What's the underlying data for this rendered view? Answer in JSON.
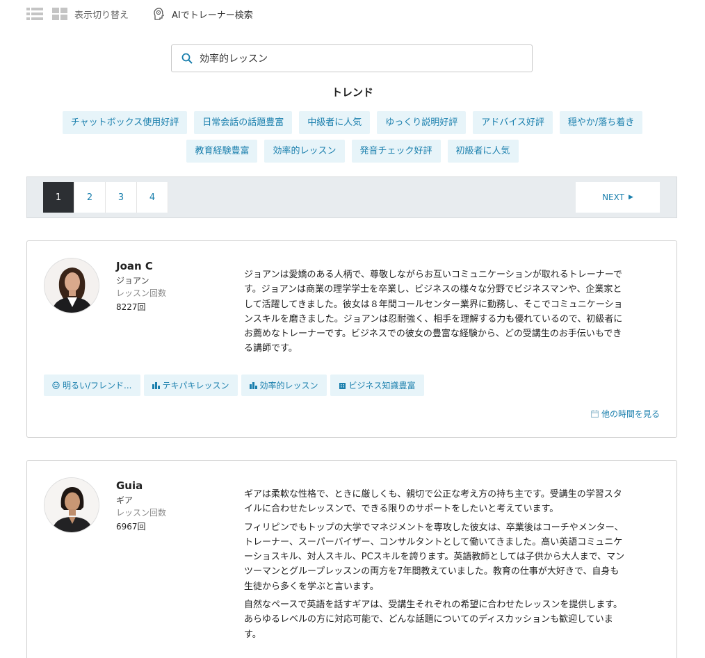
{
  "toolbar": {
    "view_toggle_label": "表示切り替え",
    "ai_search_label": "AIでトレーナー検索"
  },
  "search": {
    "value": "効率的レッスン"
  },
  "trend": {
    "title": "トレンド",
    "row1": [
      "チャットボックス使用好評",
      "日常会話の話題豊富",
      "中級者に人気",
      "ゆっくり説明好評",
      "アドバイス好評",
      "穏やか/落ち着き"
    ],
    "row2": [
      "教育経験豊富",
      "効率的レッスン",
      "発音チェック好評",
      "初級者に人気"
    ]
  },
  "pagination": {
    "pages": [
      "1",
      "2",
      "3",
      "4"
    ],
    "active_page": "1",
    "next_label": "NEXT"
  },
  "trainers": [
    {
      "name": "Joan C",
      "kana": "ジョアン",
      "count_label": "レッスン回数",
      "count": "8227回",
      "bio": [
        "ジョアンは愛嬌のある人柄で、尊敬しながらお互いコミュニケーションが取れるトレーナーです。ジョアンは商業の理学学士を卒業し、ビジネスの様々な分野でビジネスマンや、企業家として活躍してきました。彼女は８年間コールセンター業界に勤務し、そこでコミュニケーションスキルを磨きました。ジョアンは忍耐強く、相手を理解する力も優れているので、初級者にお薦めなトレーナーです。ビジネスでの彼女の豊富な経験から、どの受講生のお手伝いもできる講師です。"
      ],
      "chips": [
        {
          "label": "明るい/フレンド...",
          "icon": "smile-icon"
        },
        {
          "label": "テキパキレッスン",
          "icon": "bar-chart-icon"
        },
        {
          "label": "効率的レッスン",
          "icon": "bar-chart-icon"
        },
        {
          "label": "ビジネス知識豊富",
          "icon": "building-icon"
        }
      ],
      "more_times_label": "他の時間を見る"
    },
    {
      "name": "Guia",
      "kana": "ギア",
      "count_label": "レッスン回数",
      "count": "6967回",
      "bio": [
        "ギアは柔軟な性格で、ときに厳しくも、親切で公正な考え方の持ち主です。受講生の学習スタイルに合わせたレッスンで、できる限りのサポートをしたいと考えています。",
        "フィリピンでもトップの大学でマネジメントを専攻した彼女は、卒業後はコーチやメンター、トレーナー、スーパーバイザー、コンサルタントとして働いてきました。高い英語コミュニケーショスキル、対人スキル、PCスキルを誇ります。英語教師としては子供から大人まで、マンツーマンとグループレッスンの両方を7年間教えていました。教育の仕事が大好きで、自身も生徒から多くを学ぶと言います。",
        "自然なペースで英語を話すギアは、受講生それぞれの希望に合わせたレッスンを提供します。あらゆるレベルの方に対応可能で、どんな話題についてのディスカッションも歓迎しています。"
      ]
    }
  ]
}
